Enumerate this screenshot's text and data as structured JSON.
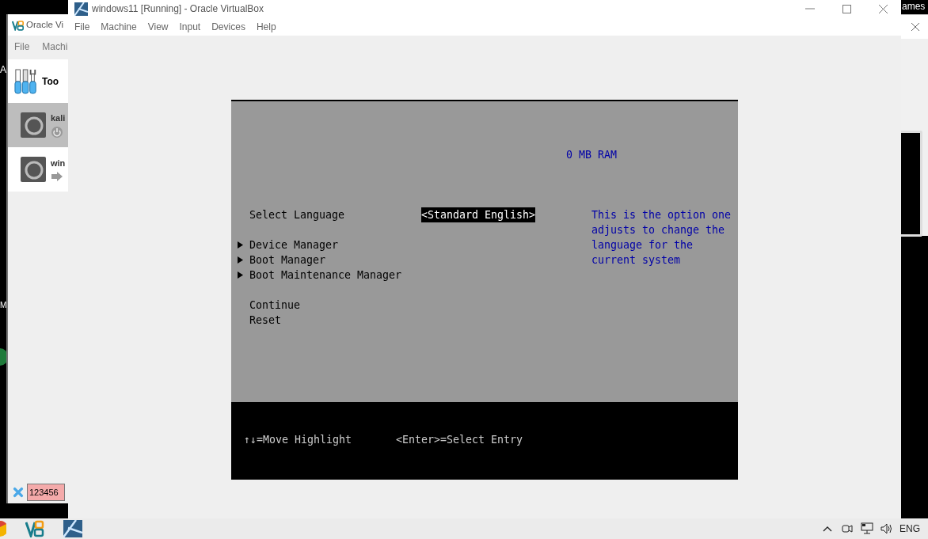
{
  "desktop": {
    "icon_labels": [
      "A",
      "M"
    ]
  },
  "manager_window": {
    "title": "Oracle Vi",
    "menu": [
      "File",
      "Machi"
    ],
    "tools_label": "Too",
    "machines": [
      {
        "name": "kali",
        "selected": true,
        "kind": "powered-off"
      },
      {
        "name": "win",
        "selected": false,
        "kind": "saved"
      }
    ],
    "search_value": "123456"
  },
  "right_window": {
    "title_fragment": "ames"
  },
  "vm_window": {
    "title": "windows11 [Running] - Oracle VirtualBox",
    "menu": [
      "File",
      "Machine",
      "View",
      "Input",
      "Devices",
      "Help"
    ],
    "firmware": {
      "memory": "0 MB RAM",
      "groups": [
        [
          {
            "kind": "option",
            "label": "Select Language",
            "value": "<Standard English>",
            "selected": true
          }
        ],
        [
          {
            "kind": "submenu",
            "label": "Device Manager",
            "selected": false
          },
          {
            "kind": "submenu",
            "label": "Boot Manager",
            "selected": false
          },
          {
            "kind": "submenu",
            "label": "Boot Maintenance Manager",
            "selected": false
          }
        ],
        [
          {
            "kind": "action",
            "label": "Continue",
            "selected": false
          },
          {
            "kind": "action",
            "label": "Reset",
            "selected": false
          }
        ]
      ],
      "help": "This is the option one adjusts to change the language for the current system",
      "footer": [
        "↑↓=Move Highlight",
        "<Enter>=Select Entry"
      ]
    }
  },
  "taskbar": {
    "language": "ENG"
  }
}
